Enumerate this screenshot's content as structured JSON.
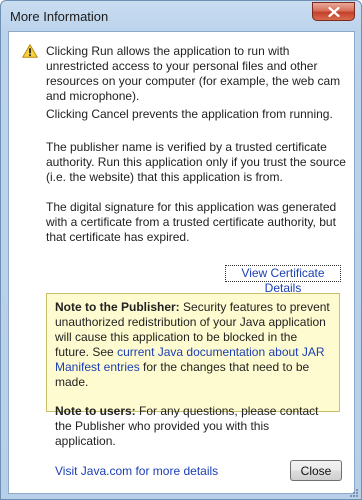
{
  "window": {
    "title": "More Information"
  },
  "messages": {
    "run_info": "Clicking Run allows the application to run with unrestricted access to your personal files and other resources on your computer (for example, the web cam and microphone).",
    "cancel_info": "Clicking Cancel prevents the application from running.",
    "publisher_info": "The publisher name is verified by a trusted certificate authority. Run this application only if you trust the source (i.e. the website) that this application is from.",
    "signature_info": "The digital signature for this application was generated with a certificate from a trusted certificate authority, but that certificate has expired."
  },
  "links": {
    "view_certificate": "View Certificate Details",
    "visit_java": "Visit Java.com for more details"
  },
  "note": {
    "publisher_heading": "Note to the Publisher:",
    "publisher_text_1": "Security features to prevent unauthorized redistribution of your Java application will cause this application to be blocked in the future. See",
    "publisher_link": "current Java documentation about JAR Manifest entries",
    "publisher_text_2": "for the changes that need to be made.",
    "users_heading": "Note to users:",
    "users_text": "For any questions, please contact the Publisher who provided you with this application."
  },
  "buttons": {
    "close": "Close"
  },
  "icons": {
    "warning": "warning-triangle-icon",
    "close": "close-x-icon",
    "grip": "resize-grip-icon"
  },
  "colors": {
    "link": "#1a3fb5",
    "note_bg": "#fffbd0",
    "title_bar": "#bcd3ec",
    "close_red": "#c4412a"
  }
}
